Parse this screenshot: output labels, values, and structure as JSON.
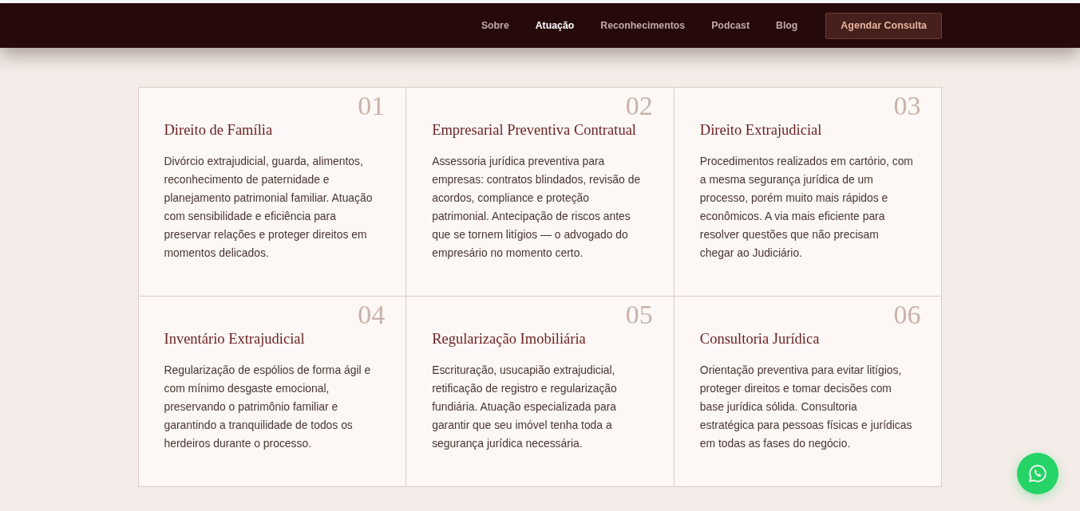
{
  "nav": {
    "links": [
      {
        "label": "Sobre",
        "selected": false
      },
      {
        "label": "Atuação",
        "selected": true
      },
      {
        "label": "Reconhecimentos",
        "selected": false
      },
      {
        "label": "Podcast",
        "selected": false
      },
      {
        "label": "Blog",
        "selected": false
      }
    ],
    "cta": "Agendar Consulta"
  },
  "services": [
    {
      "number": "01",
      "title": "Direito de Família",
      "description": "Divórcio extrajudicial, guarda, alimentos, reconhecimento de paternidade e planejamento patrimonial familiar. Atuação com sensibilidade e eficiência para preservar relações e proteger direitos em momentos delicados."
    },
    {
      "number": "02",
      "title": "Empresarial Preventiva Contratual",
      "description": "Assessoria jurídica preventiva para empresas: contratos blindados, revisão de acordos, compliance e proteção patrimonial. Antecipação de riscos antes que se tornem litígios — o advogado do empresário no momento certo."
    },
    {
      "number": "03",
      "title": "Direito Extrajudicial",
      "description": "Procedimentos realizados em cartório, com a mesma segurança jurídica de um processo, porém muito mais rápidos e econômicos. A via mais eficiente para resolver questões que não precisam chegar ao Judiciário."
    },
    {
      "number": "04",
      "title": "Inventário Extrajudicial",
      "description": "Regularização de espólios de forma ágil e com mínimo desgaste emocional, preservando o patrimônio familiar e garantindo a tranquilidade de todos os herdeiros durante o processo."
    },
    {
      "number": "05",
      "title": "Regularização Imobiliária",
      "description": "Escrituração, usucapião extrajudicial, retificação de registro e regularização fundiária. Atuação especializada para garantir que seu imóvel tenha toda a segurança jurídica necessária."
    },
    {
      "number": "06",
      "title": "Consultoria Jurídica",
      "description": "Orientação preventiva para evitar litígios, proteger direitos e tomar decisões com base jurídica sólida. Consultoria estratégica para pessoas físicas e jurídicas em todas as fases do negócio."
    }
  ]
}
